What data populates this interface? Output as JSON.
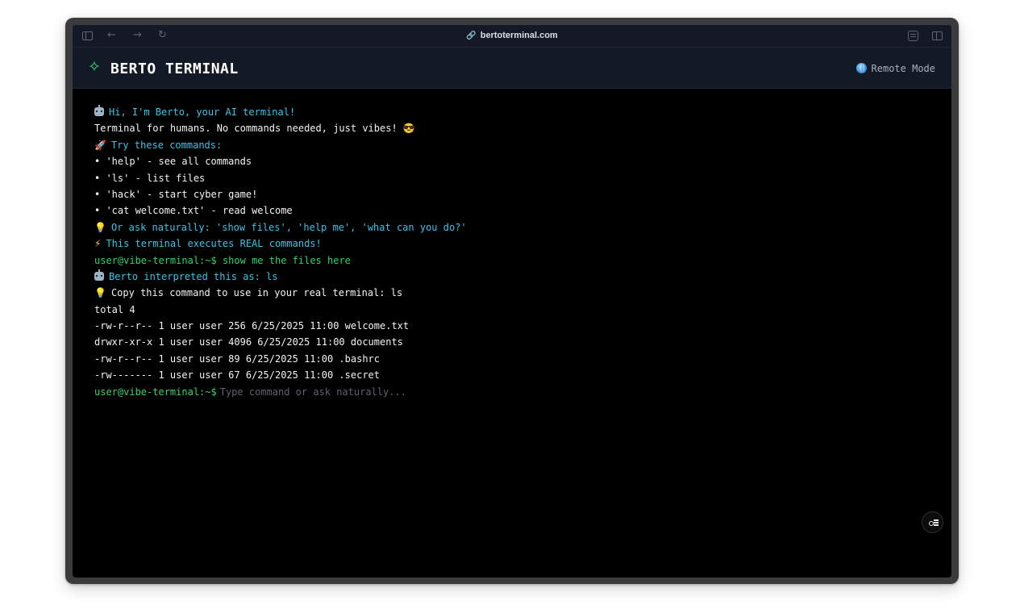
{
  "browser": {
    "url": "bertoterminal.com",
    "icons": [
      "sidebar-icon",
      "back-icon",
      "forward-icon",
      "reload-icon",
      "link-icon",
      "reader-icon",
      "split-view-icon"
    ]
  },
  "header": {
    "title": "BERTO TERMINAL",
    "mode_label": "Remote Mode",
    "accent": "#2ee07a"
  },
  "terminal": {
    "welcome": "Hi, I'm Berto, your AI terminal!",
    "tagline": "Terminal for humans. No commands needed, just vibes! 😎",
    "try_heading": "Try these commands:",
    "tips": [
      "• 'help' - see all commands",
      "• 'ls' - list files",
      "• 'hack' - start cyber game!",
      "• 'cat welcome.txt' - read welcome"
    ],
    "ask_hint": "Or ask naturally: 'show files', 'help me', 'what can you do?'",
    "executes_note": "This terminal executes REAL commands!",
    "prompt": "user@vibe-terminal:~$",
    "user_input": "show me the files here",
    "interpreted": "Berto interpreted this as: ls",
    "copy_hint": "Copy this command to use in your real terminal: ls",
    "output": [
      "total 4",
      "-rw-r--r-- 1 user user 256 6/25/2025 11:00 welcome.txt",
      "drwxr-xr-x 1 user user 4096 6/25/2025 11:00 documents",
      "-rw-r--r-- 1 user user 89 6/25/2025 11:00 .bashrc",
      "-rw------- 1 user user 67 6/25/2025 11:00 .secret"
    ],
    "input_placeholder": "Type command or ask naturally..."
  },
  "colors": {
    "cyan": "#36c5ea",
    "green": "#37d06c",
    "background": "#000000"
  }
}
